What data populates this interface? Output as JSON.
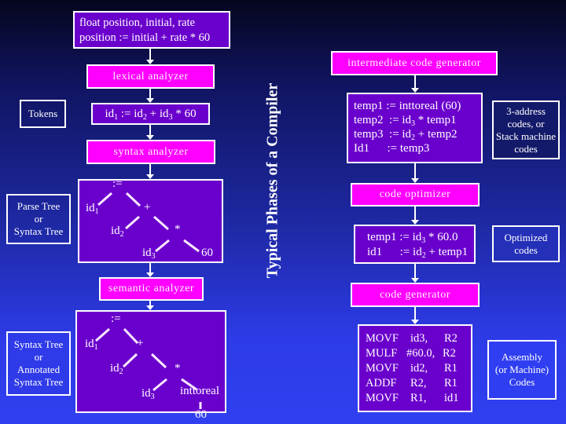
{
  "title": "Typical Phases of a Compiler",
  "source": {
    "lines": [
      "float position, initial, rate",
      "position := initial + rate * 60"
    ]
  },
  "phases": {
    "lexical": "lexical analyzer",
    "syntax": "syntax analyzer",
    "semantic": "semantic analyzer",
    "intermediate": "intermediate code generator",
    "optimizer": "code optimizer",
    "generator": "code generator"
  },
  "tokens": {
    "parts": [
      {
        "base": "id",
        "sub": "1"
      },
      {
        "text": " := "
      },
      {
        "base": "id",
        "sub": "2"
      },
      {
        "text": " + "
      },
      {
        "base": "id",
        "sub": "3"
      },
      {
        "text": " * 60"
      }
    ]
  },
  "labels": {
    "tokens": "Tokens",
    "parse_tree": [
      "Parse Tree",
      "or",
      "Syntax Tree"
    ],
    "annotated_tree": [
      "Syntax Tree",
      "or",
      "Annotated",
      "Syntax Tree"
    ],
    "three_address": [
      "3-address",
      "codes, or",
      "Stack machine",
      "codes"
    ],
    "optimized": [
      "Optimized",
      "codes"
    ],
    "assembly": [
      "Assembly",
      "(or Machine)",
      "Codes"
    ]
  },
  "parse_tree": {
    "nodes": [
      {
        "id": "assign",
        "text": ":="
      },
      {
        "id": "id1",
        "base": "id",
        "sub": "1"
      },
      {
        "id": "plus",
        "text": "+"
      },
      {
        "id": "id2",
        "base": "id",
        "sub": "2"
      },
      {
        "id": "mul",
        "text": "*"
      },
      {
        "id": "id3",
        "base": "id",
        "sub": "3"
      },
      {
        "id": "c60",
        "text": "60"
      }
    ],
    "edges": [
      [
        "assign",
        "id1"
      ],
      [
        "assign",
        "plus"
      ],
      [
        "plus",
        "id2"
      ],
      [
        "plus",
        "mul"
      ],
      [
        "mul",
        "id3"
      ],
      [
        "mul",
        "c60"
      ]
    ]
  },
  "annotated_tree": {
    "nodes": [
      {
        "id": "assign",
        "text": ":="
      },
      {
        "id": "id1",
        "base": "id",
        "sub": "1"
      },
      {
        "id": "plus",
        "text": "+"
      },
      {
        "id": "id2",
        "base": "id",
        "sub": "2"
      },
      {
        "id": "mul",
        "text": "*"
      },
      {
        "id": "id3",
        "base": "id",
        "sub": "3"
      },
      {
        "id": "conv",
        "text": "inttoreal"
      },
      {
        "id": "c60",
        "text": "60"
      }
    ],
    "edges": [
      [
        "assign",
        "id1"
      ],
      [
        "assign",
        "plus"
      ],
      [
        "plus",
        "id2"
      ],
      [
        "plus",
        "mul"
      ],
      [
        "mul",
        "id3"
      ],
      [
        "mul",
        "conv"
      ],
      [
        "conv",
        "c60"
      ]
    ]
  },
  "intermediate_code": [
    [
      {
        "text": "temp1 := inttoreal (60)"
      }
    ],
    [
      {
        "text": "temp2  := "
      },
      {
        "base": "id",
        "sub": "3"
      },
      {
        "text": " * temp1"
      }
    ],
    [
      {
        "text": "temp3  := "
      },
      {
        "base": "id",
        "sub": "2"
      },
      {
        "text": " + temp2"
      }
    ],
    [
      {
        "text": "Id1      := temp3"
      }
    ]
  ],
  "optimized_code": [
    [
      {
        "text": "temp1 := "
      },
      {
        "base": "id",
        "sub": "3"
      },
      {
        "text": " * 60.0"
      }
    ],
    [
      {
        "text": "id1      := "
      },
      {
        "base": "id",
        "sub": "2"
      },
      {
        "text": " + temp1"
      }
    ]
  ],
  "assembly_code": [
    [
      "MOVF",
      "id3,",
      "R2"
    ],
    [
      "MULF",
      "#60.0,",
      "R2"
    ],
    [
      "MOVF",
      "id2,",
      "R1"
    ],
    [
      "ADDF",
      "R2,",
      "R1"
    ],
    [
      "MOVF",
      "R1,",
      "id1"
    ]
  ]
}
